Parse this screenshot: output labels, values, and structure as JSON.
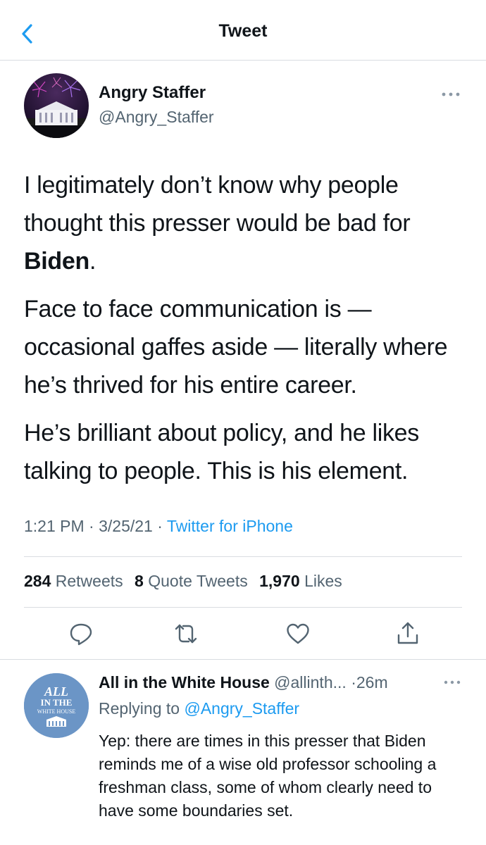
{
  "nav": {
    "title": "Tweet"
  },
  "tweet": {
    "author_name": "Angry Staffer",
    "author_handle": "@Angry_Staffer",
    "para1_pre": "I legitimately don’t know why people thought this presser would be bad for ",
    "para1_bold": "Biden",
    "para1_post": ".",
    "para2": "Face to face communication is — occasional gaffes aside — literally where he’s thrived for his entire career.",
    "para3": "He’s brilliant about policy, and he likes talking to people. This is his element.",
    "time": "1:21 PM",
    "date": "3/25/21",
    "source": "Twitter for iPhone",
    "retweets_count": "284",
    "retweets_label": "Retweets",
    "quotes_count": "8",
    "quotes_label": "Quote Tweets",
    "likes_count": "1,970",
    "likes_label": "Likes"
  },
  "reply": {
    "name": "All in the White House",
    "handle": "@allinth...",
    "time": "26m",
    "replying_label": "Replying to",
    "replying_to": "@Angry_Staffer",
    "body": "Yep: there are times in this presser that Biden reminds me of a wise old professor schooling a freshman class, some of whom clearly need to have some boundaries set.",
    "avatar_line1": "ALL",
    "avatar_line2": "IN THE",
    "avatar_line3": "WHITE HOUSE"
  },
  "colors": {
    "link": "#1d9bf0",
    "secondary": "#536471",
    "primary": "#0f1419",
    "divider": "#d9dde1"
  },
  "icons": [
    "back-chevron-icon",
    "more-icon",
    "reply-icon",
    "retweet-icon",
    "like-icon",
    "share-icon"
  ]
}
